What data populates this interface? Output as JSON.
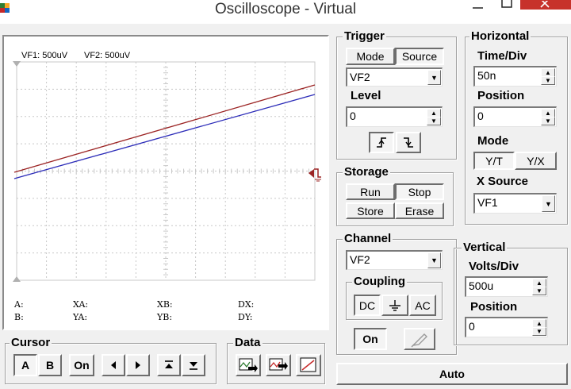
{
  "window": {
    "title": "Oscilloscope - Virtual"
  },
  "screen": {
    "channel_labels": {
      "vf1": "VF1: 500uV",
      "vf2": "VF2: 500uV"
    },
    "readouts": {
      "a": "A:",
      "b": "B:",
      "xa": "XA:",
      "ya": "YA:",
      "xb": "XB:",
      "yb": "YB:",
      "dx": "DX:",
      "dy": "DY:"
    }
  },
  "trigger": {
    "title": "Trigger",
    "mode_label": "Mode",
    "source_label": "Source",
    "source_value": "VF2",
    "level_label": "Level",
    "level_value": "0"
  },
  "horizontal": {
    "title": "Horizontal",
    "time_div_label": "Time/Div",
    "time_div_value": "50n",
    "position_label": "Position",
    "position_value": "0",
    "mode_label": "Mode",
    "yt_label": "Y/T",
    "yx_label": "Y/X",
    "xsource_label": "X Source",
    "xsource_value": "VF1"
  },
  "storage": {
    "title": "Storage",
    "run_label": "Run",
    "stop_label": "Stop",
    "store_label": "Store",
    "erase_label": "Erase"
  },
  "channel": {
    "title": "Channel",
    "value": "VF2",
    "coupling_label": "Coupling",
    "dc_label": "DC",
    "ac_label": "AC",
    "on_label": "On"
  },
  "vertical": {
    "title": "Vertical",
    "volts_div_label": "Volts/Div",
    "volts_div_value": "500u",
    "position_label": "Position",
    "position_value": "0"
  },
  "cursor": {
    "title": "Cursor",
    "a_label": "A",
    "b_label": "B",
    "on_label": "On"
  },
  "data": {
    "title": "Data"
  },
  "auto_label": "Auto",
  "colors": {
    "vf1_trace": "#2b2bb8",
    "vf2_trace": "#9b2323",
    "grid": "#c8c8c8",
    "close_button": "#c7322b"
  }
}
